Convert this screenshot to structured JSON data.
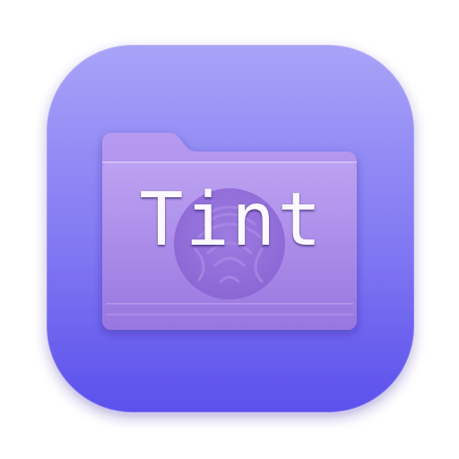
{
  "app_icon": {
    "name": "Tint",
    "label": "Tint",
    "icons": [
      "folder-icon",
      "fingerprint-icon"
    ]
  },
  "colors": {
    "background": "#ffffff",
    "squircle_top": "#a9a3f8",
    "squircle_bottom": "#5b50ec",
    "folder_back": "#a986e6",
    "folder_front_top": "#b89cf0",
    "folder_front_bottom": "#9d7be0",
    "emblem": "#8c68d6",
    "label_text": "#fbf8ff"
  }
}
